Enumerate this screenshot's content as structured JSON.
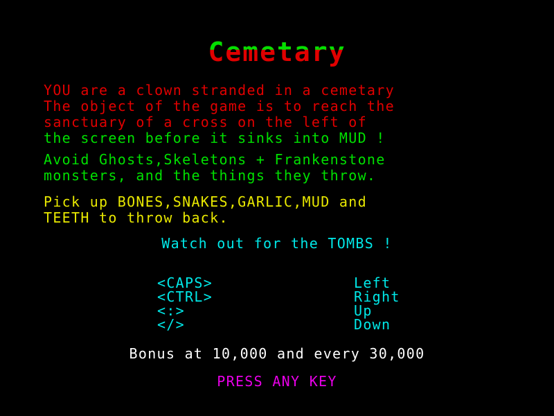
{
  "screen": {
    "background_color": "#000000",
    "title": {
      "text": "Cemetary",
      "top_color": "#00e000",
      "bottom_color": "#e00000"
    },
    "intro": {
      "color_primary": "#e00000",
      "color_secondary": "#00e000",
      "lines": [
        {
          "text": "YOU are a clown stranded in a cemetary",
          "color": "#e00000"
        },
        {
          "text": "The object of the game is to reach the",
          "color": "#e00000"
        },
        {
          "text": "sanctuary of a cross on the left of",
          "color": "#e00000"
        },
        {
          "text": "the screen before it sinks into MUD !",
          "color": "#00e000"
        }
      ]
    },
    "avoid": {
      "color": "#00e000",
      "lines": [
        "Avoid Ghosts,Skeletons + Frankenstone",
        "monsters, and the things they throw."
      ]
    },
    "pickup": {
      "color": "#e8e800",
      "lines": [
        "Pick up BONES,SNAKES,GARLIC,MUD and",
        "TEETH to throw back."
      ]
    },
    "warning": {
      "color": "#00e8e8",
      "text": "Watch out for the TOMBS !"
    },
    "controls": {
      "color": "#00e8e8",
      "rows": [
        {
          "key": "<CAPS>",
          "action": "Left"
        },
        {
          "key": "<CTRL>",
          "action": "Right"
        },
        {
          "key": "<:>",
          "action": "Up"
        },
        {
          "key": "</>",
          "action": "Down"
        }
      ]
    },
    "bonus": {
      "color": "#ffffff",
      "text": "Bonus at 10,000 and every 30,000"
    },
    "prompt": {
      "color": "#e800e8",
      "text": "PRESS ANY KEY"
    }
  }
}
